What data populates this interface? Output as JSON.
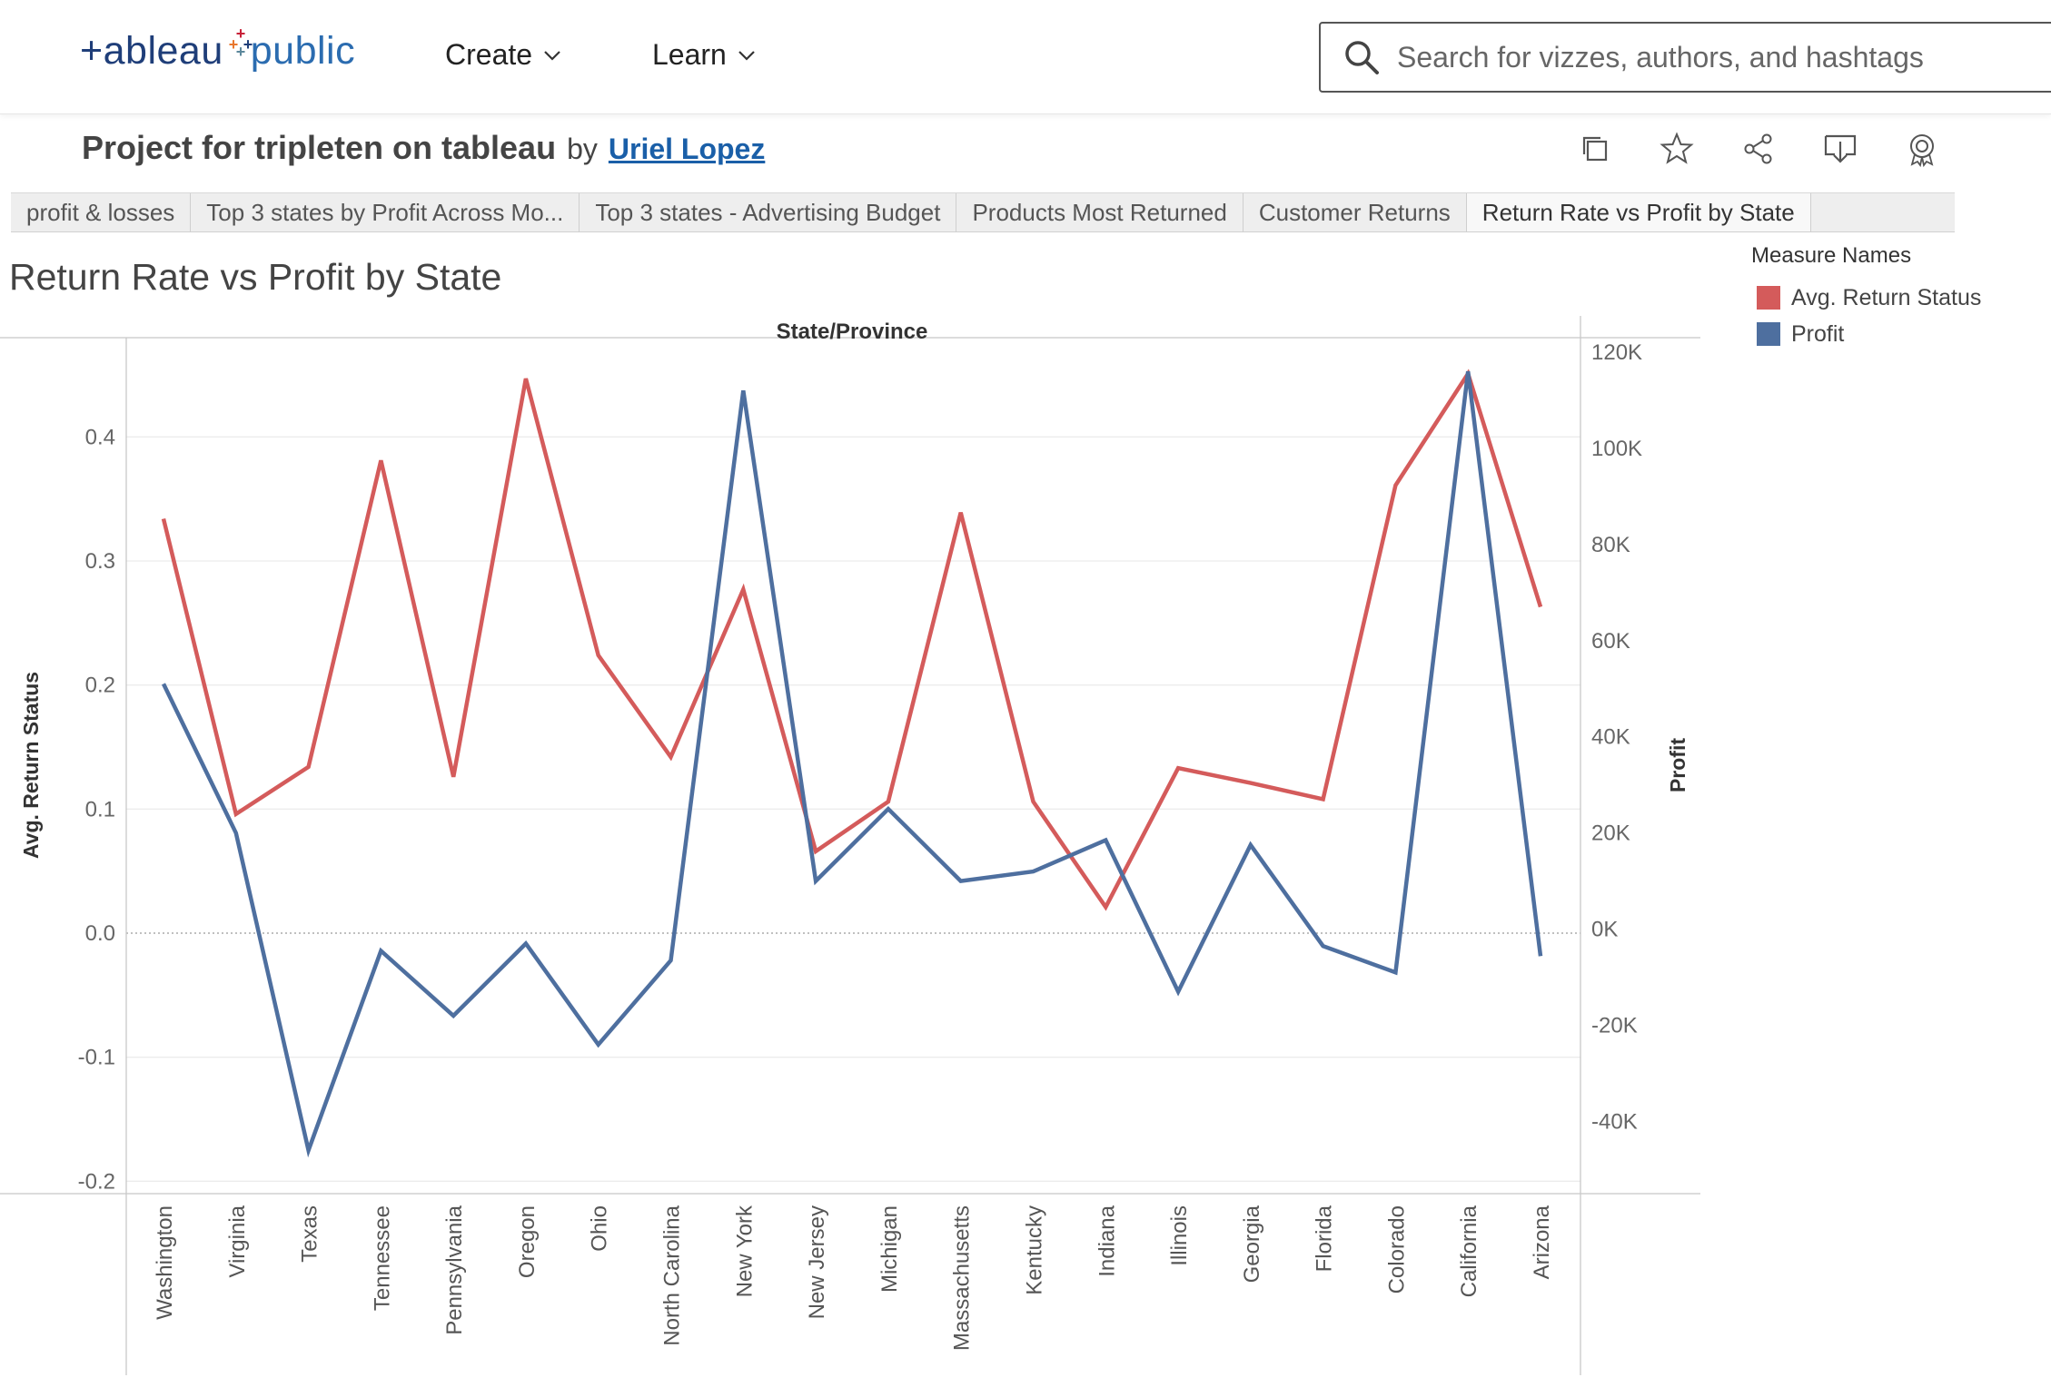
{
  "nav": {
    "logo_text_1": "+ableau",
    "logo_text_2": "public",
    "create_label": "Create",
    "learn_label": "Learn",
    "search_placeholder": "Search for vizzes, authors, and hashtags"
  },
  "viz": {
    "title": "Project for tripleten on tableau",
    "by_label": "by",
    "author": "Uriel Lopez",
    "toolbar_icons": [
      "copy-icon",
      "star-icon",
      "share-icon",
      "download-icon",
      "badge-icon"
    ]
  },
  "tabs": [
    {
      "label": "profit & losses",
      "active": false
    },
    {
      "label": "Top 3 states by Profit Across Mo...",
      "active": false
    },
    {
      "label": "Top 3 states - Advertising Budget",
      "active": false
    },
    {
      "label": "Products Most Returned",
      "active": false
    },
    {
      "label": "Customer Returns",
      "active": false
    },
    {
      "label": "Return Rate vs Profit by State",
      "active": true
    }
  ],
  "sheet": {
    "title": "Return Rate vs Profit by State"
  },
  "legend": {
    "title": "Measure Names",
    "items": [
      {
        "label": "Avg. Return Status",
        "color": "#d45b5b"
      },
      {
        "label": "Profit",
        "color": "#4e6f9f"
      }
    ]
  },
  "chart_data": {
    "type": "line",
    "title": "Return Rate vs Profit by State",
    "xlabel": "State/Province",
    "ylabel": "Avg. Return Status",
    "y2label": "Profit",
    "categories": [
      "Washington",
      "Virginia",
      "Texas",
      "Tennessee",
      "Pennsylvania",
      "Oregon",
      "Ohio",
      "North Carolina",
      "New York",
      "New Jersey",
      "Michigan",
      "Massachusetts",
      "Kentucky",
      "Indiana",
      "Illinois",
      "Georgia",
      "Florida",
      "Colorado",
      "California",
      "Arizona"
    ],
    "ylim": [
      -0.21,
      0.48
    ],
    "y2lim": [
      -55000,
      123000
    ],
    "yticks": [
      -0.2,
      -0.1,
      0.0,
      0.1,
      0.2,
      0.3,
      0.4
    ],
    "ytick_labels": [
      "-0.2",
      "-0.1",
      "0.0",
      "0.1",
      "0.2",
      "0.3",
      "0.4"
    ],
    "y2ticks": [
      -40000,
      -20000,
      0,
      20000,
      40000,
      60000,
      80000,
      100000,
      120000
    ],
    "y2tick_labels": [
      "-40K",
      "-20K",
      "0K",
      "20K",
      "40K",
      "60K",
      "80K",
      "100K",
      "120K"
    ],
    "series": [
      {
        "name": "Avg. Return Status",
        "axis": "left",
        "color": "#d45b5b",
        "values": [
          0.334,
          0.096,
          0.134,
          0.381,
          0.126,
          0.447,
          0.224,
          0.142,
          0.277,
          0.066,
          0.106,
          0.339,
          0.106,
          0.021,
          0.133,
          0.121,
          0.108,
          0.361,
          0.451,
          0.263
        ]
      },
      {
        "name": "Profit",
        "axis": "right",
        "color": "#4e6f9f",
        "values": [
          51000,
          20000,
          -46000,
          -4500,
          -18000,
          -3000,
          -24000,
          -6500,
          112000,
          10000,
          25000,
          10000,
          12000,
          18500,
          -13000,
          17500,
          -3500,
          -9000,
          116000,
          -5600
        ]
      }
    ],
    "grid": true,
    "legend_position": "top-right"
  }
}
